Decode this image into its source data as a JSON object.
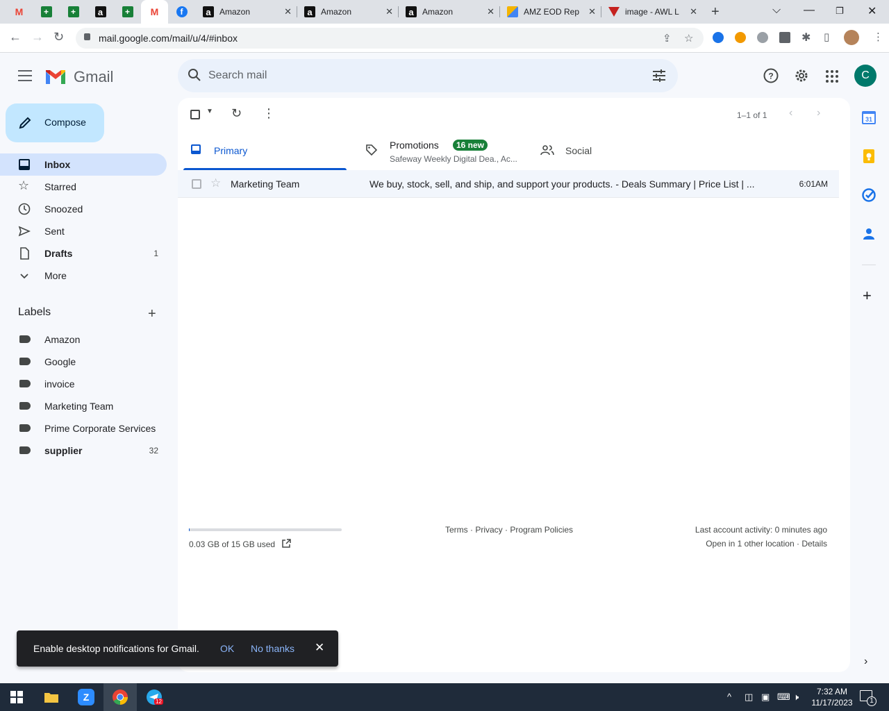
{
  "browser": {
    "tabs": [
      {
        "kind": "pinned",
        "icon": "gmail-icon"
      },
      {
        "kind": "pinned",
        "icon": "sheets-icon"
      },
      {
        "kind": "pinned",
        "icon": "sheets-icon"
      },
      {
        "kind": "pinned",
        "icon": "amazon-icon"
      },
      {
        "kind": "pinned",
        "icon": "sheets-icon"
      },
      {
        "kind": "pinned",
        "icon": "gmail-icon",
        "active": true
      },
      {
        "kind": "pinned",
        "icon": "facebook-icon"
      },
      {
        "kind": "full",
        "icon": "amazon-icon",
        "title": "Amazon"
      },
      {
        "kind": "full",
        "icon": "amazon-icon",
        "title": "Amazon"
      },
      {
        "kind": "full",
        "icon": "amazon-icon",
        "title": "Amazon"
      },
      {
        "kind": "full",
        "icon": "amz-eod-icon",
        "title": "AMZ EOD Rep"
      },
      {
        "kind": "full",
        "icon": "awl-icon",
        "title": "image - AWL L"
      }
    ],
    "url": "mail.google.com/mail/u/4/#inbox"
  },
  "gmail": {
    "logo_text": "Gmail",
    "search_placeholder": "Search mail",
    "account_initial": "C",
    "compose_label": "Compose",
    "nav": [
      {
        "label": "Inbox",
        "icon": "inbox-icon",
        "active": true,
        "bold": true,
        "count": ""
      },
      {
        "label": "Starred",
        "icon": "star-icon",
        "count": ""
      },
      {
        "label": "Snoozed",
        "icon": "clock-icon",
        "count": ""
      },
      {
        "label": "Sent",
        "icon": "send-icon",
        "count": ""
      },
      {
        "label": "Drafts",
        "icon": "draft-icon",
        "bold": true,
        "count": "1"
      },
      {
        "label": "More",
        "icon": "chevron-down-icon",
        "count": ""
      }
    ],
    "labels_header": "Labels",
    "labels": [
      {
        "label": "Amazon",
        "count": ""
      },
      {
        "label": "Google",
        "count": ""
      },
      {
        "label": "invoice",
        "count": ""
      },
      {
        "label": "Marketing Team",
        "count": ""
      },
      {
        "label": "Prime Corporate Services",
        "count": ""
      },
      {
        "label": "supplier",
        "count": "32",
        "bold": true
      }
    ],
    "pager": "1–1 of 1",
    "category_tabs": {
      "primary": "Primary",
      "promotions": "Promotions",
      "promotions_badge": "16 new",
      "promotions_sub": "Safeway Weekly Digital Dea., Ac...",
      "social": "Social"
    },
    "emails": [
      {
        "sender": "Marketing Team",
        "subject": "We buy, stock, sell, and ship, and support your products. - Deals Summary | Price List | ...",
        "time": "6:01AM"
      }
    ],
    "storage_used": "0.03 GB of 15 GB used",
    "storage_fraction": 0.002,
    "footer": {
      "terms": "Terms",
      "privacy": "Privacy",
      "policies": "Program Policies",
      "sep": " · ",
      "last_activity": "Last account activity: 0 minutes ago",
      "open_in": "Open in 1 other location",
      "details": "Details"
    },
    "snackbar": {
      "message": "Enable desktop notifications for Gmail.",
      "ok": "OK",
      "no_thanks": "No thanks"
    }
  },
  "taskbar": {
    "time": "7:32 AM",
    "date": "11/17/2023",
    "telegram_badge": "12",
    "notification_count": "1"
  }
}
